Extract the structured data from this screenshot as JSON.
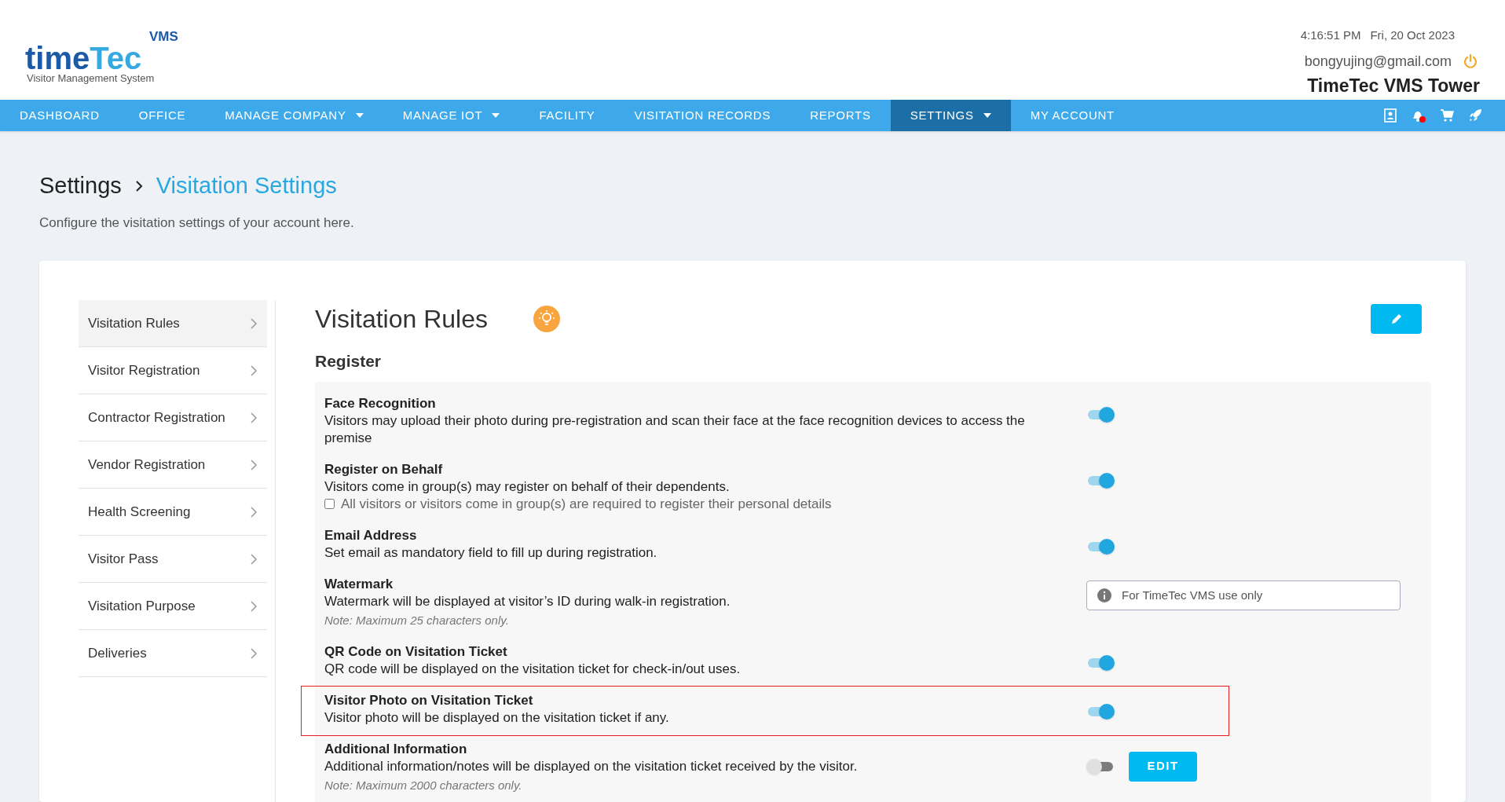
{
  "logo": {
    "wordmark_parts": [
      "time",
      "Tec"
    ],
    "superscript": "VMS",
    "tagline": "Visitor Management System"
  },
  "header": {
    "time": "4:16:51 PM",
    "date": "Fri, 20 Oct 2023",
    "email": "bongyujing@gmail.com",
    "company": "TimeTec VMS Tower"
  },
  "nav": [
    {
      "label": "DASHBOARD",
      "selected": false,
      "dropdown": false
    },
    {
      "label": "OFFICE",
      "selected": false,
      "dropdown": false
    },
    {
      "label": "MANAGE COMPANY",
      "selected": false,
      "dropdown": true
    },
    {
      "label": "MANAGE IOT",
      "selected": false,
      "dropdown": true
    },
    {
      "label": "FACILITY",
      "selected": false,
      "dropdown": false
    },
    {
      "label": "VISITATION RECORDS",
      "selected": false,
      "dropdown": false
    },
    {
      "label": "REPORTS",
      "selected": false,
      "dropdown": false
    },
    {
      "label": "SETTINGS",
      "selected": true,
      "dropdown": true
    },
    {
      "label": "MY ACCOUNT",
      "selected": false,
      "dropdown": false
    }
  ],
  "breadcrumb": [
    "Settings",
    "Visitation Settings"
  ],
  "page_description": "Configure the visitation settings of your account here.",
  "sidebar": {
    "items": [
      {
        "label": "Visitation Rules",
        "selected": true
      },
      {
        "label": "Visitor Registration",
        "selected": false
      },
      {
        "label": "Contractor Registration",
        "selected": false
      },
      {
        "label": "Vendor Registration",
        "selected": false
      },
      {
        "label": "Health Screening",
        "selected": false
      },
      {
        "label": "Visitor Pass",
        "selected": false
      },
      {
        "label": "Visitation Purpose",
        "selected": false
      },
      {
        "label": "Deliveries",
        "selected": false
      }
    ]
  },
  "panel": {
    "title": "Visitation Rules",
    "section": "Register",
    "rules": [
      {
        "kind": "toggle",
        "title": "Face Recognition",
        "description": "Visitors may upload their photo during pre-registration and scan their face at the face recognition devices to access the premise",
        "on": true,
        "highlighted": false
      },
      {
        "kind": "toggle",
        "title": "Register on Behalf",
        "description": "Visitors come in group(s) may register on behalf of their dependents.",
        "checkbox": {
          "label": "All visitors or visitors come in group(s) are required to register their personal details",
          "checked": false
        },
        "on": true,
        "highlighted": false
      },
      {
        "kind": "toggle",
        "title": "Email Address",
        "description": "Set email as mandatory field to fill up during registration.",
        "on": true,
        "highlighted": false
      },
      {
        "kind": "input",
        "title": "Watermark",
        "description": "Watermark will be displayed at visitor’s ID during walk-in registration.",
        "note": "Note: Maximum 25 characters only.",
        "value": "For TimeTec VMS use only",
        "highlighted": false
      },
      {
        "kind": "toggle",
        "title": "QR Code on Visitation Ticket",
        "description": "QR code will be displayed on the visitation ticket for check-in/out uses.",
        "on": true,
        "highlighted": false
      },
      {
        "kind": "toggle",
        "title": "Visitor Photo on Visitation Ticket",
        "description": "Visitor photo will be displayed on the visitation ticket if any.",
        "on": true,
        "highlighted": true
      },
      {
        "kind": "toggle",
        "title": "Additional Information",
        "description": "Additional information/notes will be displayed on the visitation ticket received by the visitor.",
        "note": "Note: Maximum 2000 characters only.",
        "on": false,
        "button": "EDIT",
        "highlighted": false
      }
    ]
  }
}
